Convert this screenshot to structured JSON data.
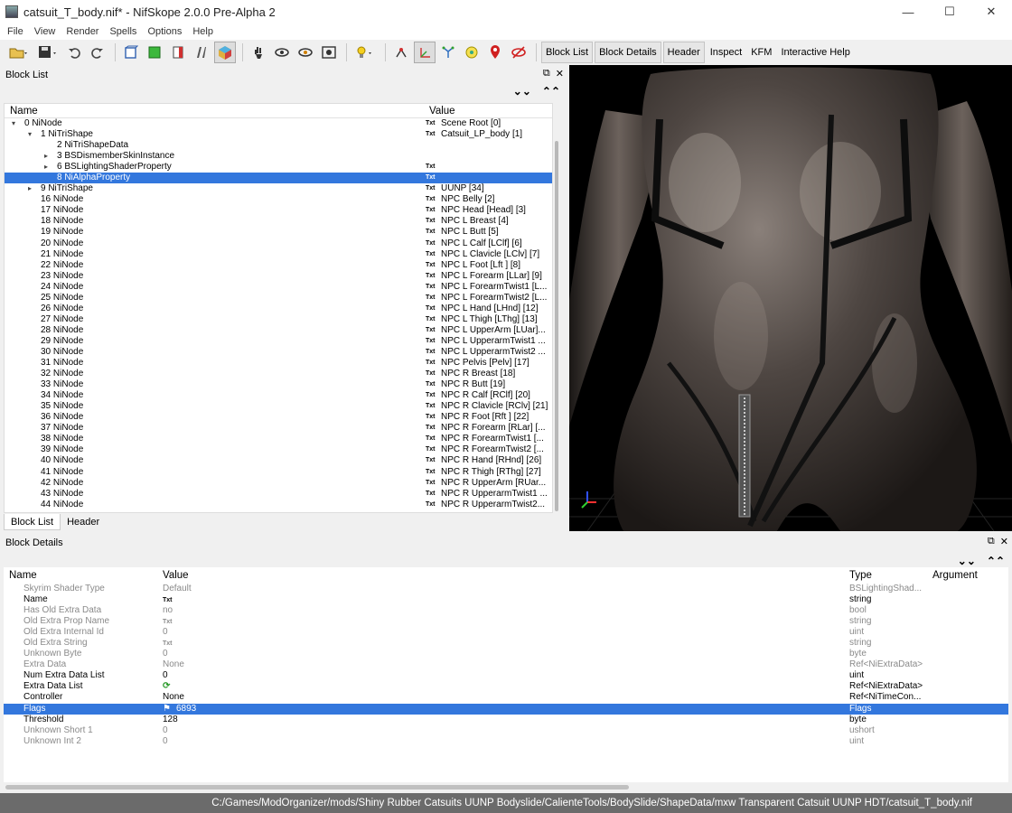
{
  "window": {
    "title": "catsuit_T_body.nif* - NifSkope 2.0.0 Pre-Alpha 2",
    "minimize": "—",
    "maximize": "☐",
    "close": "✕"
  },
  "menu": [
    "File",
    "View",
    "Render",
    "Spells",
    "Options",
    "Help"
  ],
  "toolbar": {
    "tabs": [
      "Block List",
      "Block Details",
      "Header",
      "Inspect",
      "KFM",
      "Interactive Help"
    ]
  },
  "block_list": {
    "title": "Block List",
    "columns": {
      "name": "Name",
      "value": "Value"
    },
    "rows": [
      {
        "name": "0 NiNode",
        "value": "Scene Root [0]",
        "level": 0,
        "arrow": "⌄",
        "txt": true
      },
      {
        "name": "1 NiTriShape",
        "value": "Catsuit_LP_body [1]",
        "level": 1,
        "arrow": "⌄",
        "txt": true
      },
      {
        "name": "2 NiTriShapeData",
        "value": "",
        "level": 2,
        "arrow": "",
        "txt": false
      },
      {
        "name": "3 BSDismemberSkinInstance",
        "value": "",
        "level": 2,
        "arrow": "›",
        "txt": false
      },
      {
        "name": "6 BSLightingShaderProperty",
        "value": "",
        "level": 2,
        "arrow": "›",
        "txt": true
      },
      {
        "name": "8 NiAlphaProperty",
        "value": "",
        "level": 2,
        "arrow": "",
        "txt": true,
        "selected": true
      },
      {
        "name": "9 NiTriShape",
        "value": "UUNP [34]",
        "level": 1,
        "arrow": "›",
        "txt": true
      },
      {
        "name": "16 NiNode",
        "value": "NPC Belly [2]",
        "level": 1,
        "arrow": "",
        "txt": true
      },
      {
        "name": "17 NiNode",
        "value": "NPC Head [Head] [3]",
        "level": 1,
        "arrow": "",
        "txt": true
      },
      {
        "name": "18 NiNode",
        "value": "NPC L Breast [4]",
        "level": 1,
        "arrow": "",
        "txt": true
      },
      {
        "name": "19 NiNode",
        "value": "NPC L Butt [5]",
        "level": 1,
        "arrow": "",
        "txt": true
      },
      {
        "name": "20 NiNode",
        "value": "NPC L Calf [LClf] [6]",
        "level": 1,
        "arrow": "",
        "txt": true
      },
      {
        "name": "21 NiNode",
        "value": "NPC L Clavicle [LClv] [7]",
        "level": 1,
        "arrow": "",
        "txt": true
      },
      {
        "name": "22 NiNode",
        "value": "NPC L Foot [Lft ] [8]",
        "level": 1,
        "arrow": "",
        "txt": true
      },
      {
        "name": "23 NiNode",
        "value": "NPC L Forearm [LLar] [9]",
        "level": 1,
        "arrow": "",
        "txt": true
      },
      {
        "name": "24 NiNode",
        "value": "NPC L ForearmTwist1 [L...",
        "level": 1,
        "arrow": "",
        "txt": true
      },
      {
        "name": "25 NiNode",
        "value": "NPC L ForearmTwist2 [L...",
        "level": 1,
        "arrow": "",
        "txt": true
      },
      {
        "name": "26 NiNode",
        "value": "NPC L Hand [LHnd] [12]",
        "level": 1,
        "arrow": "",
        "txt": true
      },
      {
        "name": "27 NiNode",
        "value": "NPC L Thigh [LThg] [13]",
        "level": 1,
        "arrow": "",
        "txt": true
      },
      {
        "name": "28 NiNode",
        "value": "NPC L UpperArm [LUar]...",
        "level": 1,
        "arrow": "",
        "txt": true
      },
      {
        "name": "29 NiNode",
        "value": "NPC L UpperarmTwist1 ...",
        "level": 1,
        "arrow": "",
        "txt": true
      },
      {
        "name": "30 NiNode",
        "value": "NPC L UpperarmTwist2 ...",
        "level": 1,
        "arrow": "",
        "txt": true
      },
      {
        "name": "31 NiNode",
        "value": "NPC Pelvis [Pelv] [17]",
        "level": 1,
        "arrow": "",
        "txt": true
      },
      {
        "name": "32 NiNode",
        "value": "NPC R Breast [18]",
        "level": 1,
        "arrow": "",
        "txt": true
      },
      {
        "name": "33 NiNode",
        "value": "NPC R Butt [19]",
        "level": 1,
        "arrow": "",
        "txt": true
      },
      {
        "name": "34 NiNode",
        "value": "NPC R Calf [RClf] [20]",
        "level": 1,
        "arrow": "",
        "txt": true
      },
      {
        "name": "35 NiNode",
        "value": "NPC R Clavicle [RClv] [21]",
        "level": 1,
        "arrow": "",
        "txt": true
      },
      {
        "name": "36 NiNode",
        "value": "NPC R Foot [Rft ] [22]",
        "level": 1,
        "arrow": "",
        "txt": true
      },
      {
        "name": "37 NiNode",
        "value": "NPC R Forearm [RLar] [...",
        "level": 1,
        "arrow": "",
        "txt": true
      },
      {
        "name": "38 NiNode",
        "value": "NPC R ForearmTwist1 [...",
        "level": 1,
        "arrow": "",
        "txt": true
      },
      {
        "name": "39 NiNode",
        "value": "NPC R ForearmTwist2 [...",
        "level": 1,
        "arrow": "",
        "txt": true
      },
      {
        "name": "40 NiNode",
        "value": "NPC R Hand [RHnd] [26]",
        "level": 1,
        "arrow": "",
        "txt": true
      },
      {
        "name": "41 NiNode",
        "value": "NPC R Thigh [RThg] [27]",
        "level": 1,
        "arrow": "",
        "txt": true
      },
      {
        "name": "42 NiNode",
        "value": "NPC R UpperArm [RUar...",
        "level": 1,
        "arrow": "",
        "txt": true
      },
      {
        "name": "43 NiNode",
        "value": "NPC R UpperarmTwist1 ...",
        "level": 1,
        "arrow": "",
        "txt": true
      },
      {
        "name": "44 NiNode",
        "value": "NPC R UpperarmTwist2...",
        "level": 1,
        "arrow": "",
        "txt": true
      }
    ],
    "tabs": [
      "Block List",
      "Header"
    ]
  },
  "block_details": {
    "title": "Block Details",
    "columns": {
      "name": "Name",
      "value": "Value",
      "type": "Type",
      "argument": "Argument"
    },
    "rows": [
      {
        "name": "Skyrim Shader Type",
        "value": "Default",
        "type": "BSLightingShad...",
        "disabled": true
      },
      {
        "name": "Name",
        "value": "",
        "type": "string",
        "txt": true
      },
      {
        "name": "Has Old Extra Data",
        "value": "no",
        "type": "bool",
        "disabled": true
      },
      {
        "name": "Old Extra Prop Name",
        "value": "",
        "type": "string",
        "disabled": true,
        "txt": true
      },
      {
        "name": "Old Extra Internal Id",
        "value": "0",
        "type": "uint",
        "disabled": true
      },
      {
        "name": "Old Extra String",
        "value": "",
        "type": "string",
        "disabled": true,
        "txt": true
      },
      {
        "name": "Unknown Byte",
        "value": "0",
        "type": "byte",
        "disabled": true
      },
      {
        "name": "Extra Data",
        "value": "None",
        "type": "Ref<NiExtraData>",
        "disabled": true
      },
      {
        "name": "Num Extra Data List",
        "value": "0",
        "type": "uint"
      },
      {
        "name": "Extra Data List",
        "value": "",
        "type": "Ref<NiExtraData>",
        "icon": "refresh"
      },
      {
        "name": "Controller",
        "value": "None",
        "type": "Ref<NiTimeCon..."
      },
      {
        "name": "Flags",
        "value": "6893",
        "type": "Flags",
        "selected": true,
        "icon": "flags"
      },
      {
        "name": "Threshold",
        "value": "128",
        "type": "byte"
      },
      {
        "name": "Unknown Short 1",
        "value": "0",
        "type": "ushort",
        "disabled": true
      },
      {
        "name": "Unknown Int 2",
        "value": "0",
        "type": "uint",
        "disabled": true
      }
    ]
  },
  "status_bar": {
    "path": "C:/Games/ModOrganizer/mods/Shiny Rubber Catsuits UUNP Bodyslide/CalienteTools/BodySlide/ShapeData/mxw Transparent Catsuit UUNP HDT/catsuit_T_body.nif"
  },
  "txt_label": "Txt",
  "colors": {
    "selection": "#3377dd",
    "status_bar": "#6b6b6b",
    "viewport_bg": "#000000"
  }
}
